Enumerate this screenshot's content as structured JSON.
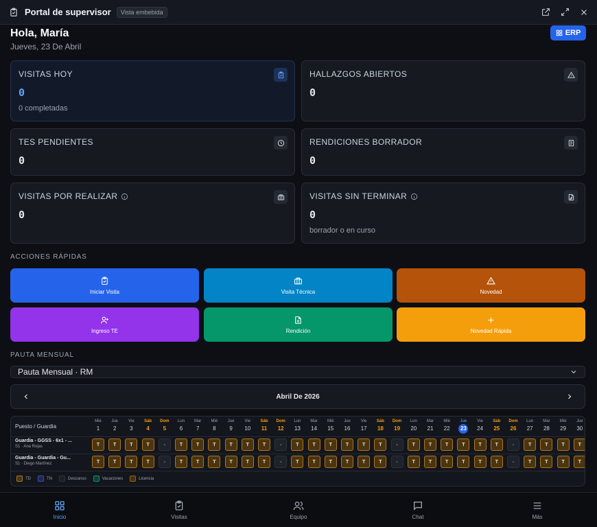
{
  "window": {
    "title": "Portal de supervisor",
    "badge": "Vista embebida",
    "icons": [
      "clipboard-icon",
      "external-link-icon",
      "expand-icon",
      "close-icon"
    ]
  },
  "header": {
    "greeting": "Hola, María",
    "date": "Jueves, 23 De Abril",
    "erp_label": "ERP"
  },
  "stats": [
    {
      "label": "VISITAS HOY",
      "value": "0",
      "sub": "0 completadas",
      "icon": "clipboard-check-icon"
    },
    {
      "label": "HALLAZGOS ABIERTOS",
      "value": "0",
      "sub": "",
      "icon": "warning-icon"
    },
    {
      "label": "TES PENDIENTES",
      "value": "0",
      "sub": "",
      "icon": "clock-icon"
    },
    {
      "label": "RENDICIONES BORRADOR",
      "value": "0",
      "sub": "",
      "icon": "receipt-icon"
    },
    {
      "label": "VISITAS POR REALIZAR",
      "value": "0",
      "sub": "",
      "icon": "briefcase-icon"
    },
    {
      "label": "VISITAS SIN TERMINAR",
      "value": "0",
      "sub": "borrador o en curso",
      "icon": "file-pen-icon"
    }
  ],
  "quick_actions": {
    "title": "ACCIONES RÁPIDAS",
    "items": [
      {
        "label": "Iniciar Visita",
        "color": "#2563eb",
        "icon": "clipboard-icon"
      },
      {
        "label": "Visita Técnica",
        "color": "#0284c7",
        "icon": "briefcase-icon"
      },
      {
        "label": "Novedad",
        "color": "#b45309",
        "icon": "warning-icon"
      },
      {
        "label": "Ingreso TE",
        "color": "#9333ea",
        "icon": "user-plus-icon"
      },
      {
        "label": "Rendición",
        "color": "#059669",
        "icon": "document-icon"
      },
      {
        "label": "Novedad Rápida",
        "color": "#f59e0b",
        "icon": "plus-icon"
      }
    ]
  },
  "pauta": {
    "title": "PAUTA MENSUAL",
    "select_value": "Pauta Mensual · RM",
    "month": "Abril De 2026",
    "column_header": "Puesto / Guardia",
    "today": 23,
    "days": [
      {
        "n": "Mié",
        "d": "1"
      },
      {
        "n": "Jue",
        "d": "2"
      },
      {
        "n": "Vie",
        "d": "3"
      },
      {
        "n": "Sáb",
        "d": "4"
      },
      {
        "n": "Dom",
        "d": "5"
      },
      {
        "n": "Lun",
        "d": "6"
      },
      {
        "n": "Mar",
        "d": "7"
      },
      {
        "n": "Mié",
        "d": "8"
      },
      {
        "n": "Jue",
        "d": "9"
      },
      {
        "n": "Vie",
        "d": "10"
      },
      {
        "n": "Sáb",
        "d": "11"
      },
      {
        "n": "Dom",
        "d": "12"
      },
      {
        "n": "Lun",
        "d": "13"
      },
      {
        "n": "Mar",
        "d": "14"
      },
      {
        "n": "Mié",
        "d": "15"
      },
      {
        "n": "Jue",
        "d": "16"
      },
      {
        "n": "Vie",
        "d": "17"
      },
      {
        "n": "Sáb",
        "d": "18"
      },
      {
        "n": "Dom",
        "d": "19"
      },
      {
        "n": "Lun",
        "d": "20"
      },
      {
        "n": "Mar",
        "d": "21"
      },
      {
        "n": "Mié",
        "d": "22"
      },
      {
        "n": "Jue",
        "d": "23"
      },
      {
        "n": "Vie",
        "d": "24"
      },
      {
        "n": "Sáb",
        "d": "25"
      },
      {
        "n": "Dom",
        "d": "26"
      },
      {
        "n": "Lun",
        "d": "27"
      },
      {
        "n": "Mar",
        "d": "28"
      },
      {
        "n": "Mié",
        "d": "29"
      },
      {
        "n": "Jue",
        "d": "30"
      }
    ],
    "guards": [
      {
        "name": "Guardia - GGSS - 6x1 - ...",
        "sub": "S1 · Ana Rojas",
        "cells": [
          "T",
          "T",
          "T",
          "T",
          "-",
          "T",
          "T",
          "T",
          "T",
          "T",
          "T",
          "-",
          "T",
          "T",
          "T",
          "T",
          "T",
          "T",
          "-",
          "T",
          "T",
          "T",
          "T",
          "T",
          "T",
          "-",
          "T",
          "T",
          "T",
          "T"
        ]
      },
      {
        "name": "Guardia - Guardia - Gu...",
        "sub": "S1 · Diego Martínez",
        "cells": [
          "T",
          "T",
          "T",
          "T",
          "-",
          "T",
          "T",
          "T",
          "T",
          "T",
          "T",
          "-",
          "T",
          "T",
          "T",
          "T",
          "T",
          "T",
          "-",
          "T",
          "T",
          "T",
          "T",
          "T",
          "T",
          "-",
          "T",
          "T",
          "T",
          "T"
        ]
      }
    ],
    "legend": [
      {
        "label": "TD",
        "color": "#b0751e"
      },
      {
        "label": "TN",
        "color": "#3b4fb8"
      },
      {
        "label": "Descanso",
        "color": "#2d323c"
      },
      {
        "label": "Vacaciones",
        "color": "#059669"
      },
      {
        "label": "Licencia",
        "color": "#a16207"
      }
    ]
  },
  "bottom_nav": [
    {
      "label": "Inicio",
      "icon": "grid-icon",
      "active": true
    },
    {
      "label": "Visitas",
      "icon": "clipboard-check-icon",
      "active": false
    },
    {
      "label": "Equipo",
      "icon": "users-icon",
      "active": false
    },
    {
      "label": "Chat",
      "icon": "chat-icon",
      "active": false
    },
    {
      "label": "Más",
      "icon": "menu-icon",
      "active": false
    }
  ]
}
